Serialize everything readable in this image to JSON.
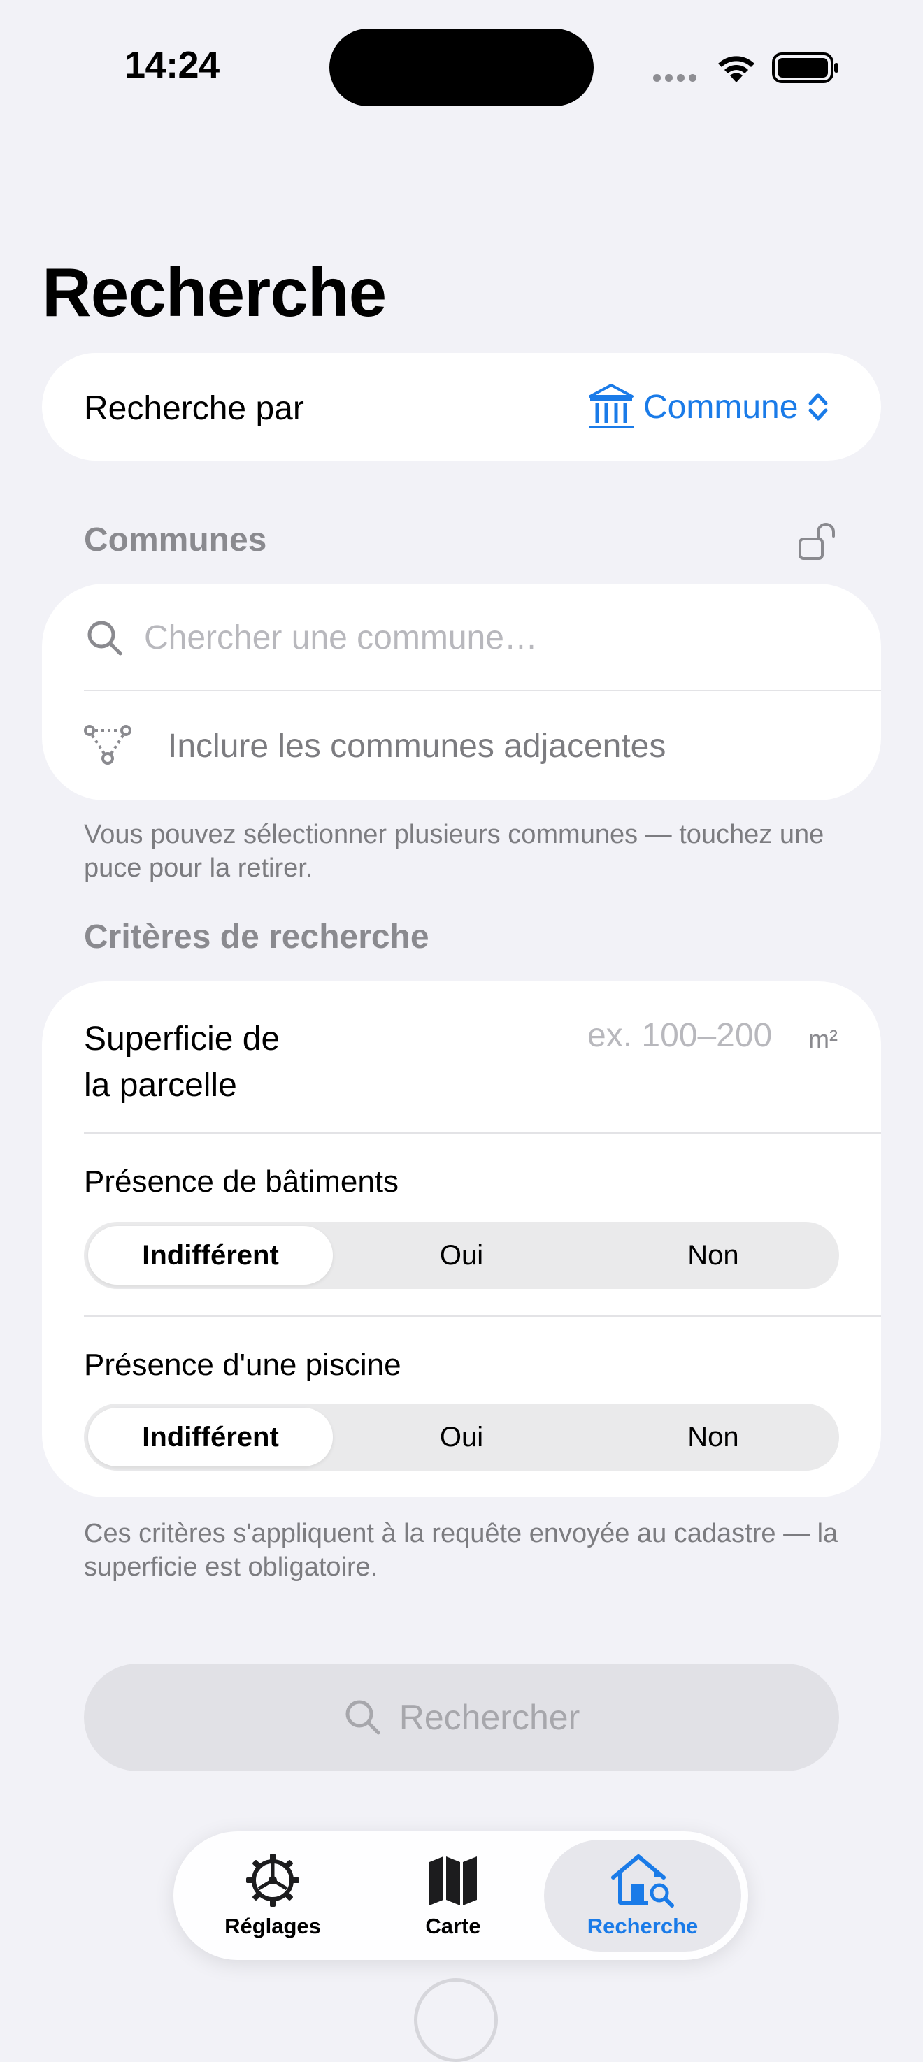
{
  "status": {
    "time": "14:24"
  },
  "page": {
    "title": "Recherche"
  },
  "search_by": {
    "label": "Recherche par",
    "value": "Commune"
  },
  "communes": {
    "section_title": "Communes",
    "search_placeholder": "Chercher une commune…",
    "include_adjacent": "Inclure les communes adjacentes",
    "footnote": "Vous pouvez sélectionner plusieurs communes — touchez une puce pour la retirer."
  },
  "criteria": {
    "section_title": "Critères de recherche",
    "area": {
      "label_line1": "Superficie de",
      "label_line2": "la parcelle",
      "placeholder": "ex. 100–200",
      "unit": "m²"
    },
    "buildings": {
      "label": "Présence de bâtiments",
      "options": [
        "Indifférent",
        "Oui",
        "Non"
      ],
      "selected": "Indifférent"
    },
    "pool": {
      "label": "Présence d'une piscine",
      "options": [
        "Indifférent",
        "Oui",
        "Non"
      ],
      "selected": "Indifférent"
    },
    "footnote": "Ces critères s'appliquent à la requête envoyée au cadastre — la superficie est obligatoire."
  },
  "search_button": {
    "label": "Rechercher"
  },
  "tabbar": {
    "items": [
      {
        "label": "Réglages",
        "icon": "gear-icon"
      },
      {
        "label": "Carte",
        "icon": "map-icon"
      },
      {
        "label": "Recherche",
        "icon": "house-search-icon"
      }
    ],
    "active": "Recherche"
  },
  "colors": {
    "accent": "#1a7be8",
    "background": "#f2f2f7"
  }
}
